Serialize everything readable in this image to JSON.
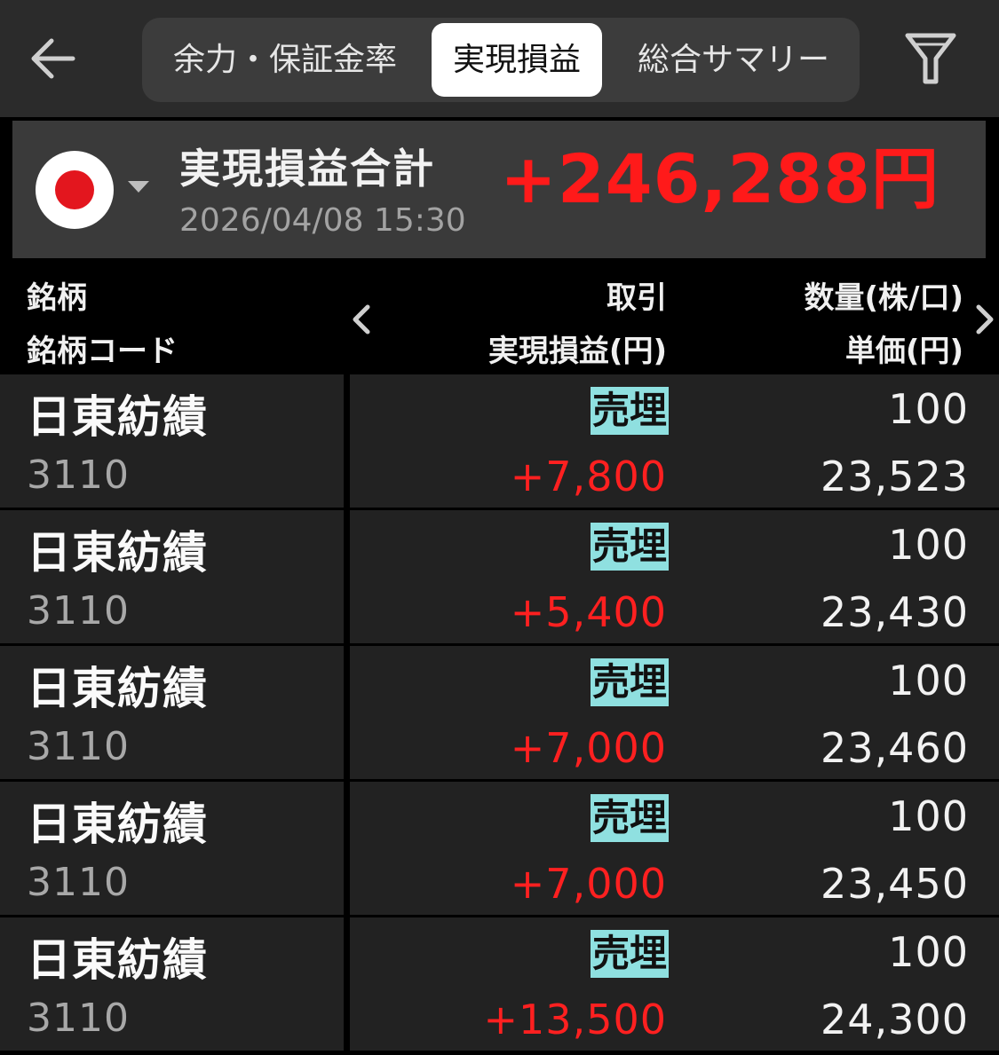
{
  "header": {
    "back_icon": "arrow-left-icon",
    "tabs": [
      {
        "label": "余力・保証金率",
        "selected": false
      },
      {
        "label": "実現損益",
        "selected": true
      },
      {
        "label": "総合サマリー",
        "selected": false
      }
    ],
    "filter_icon": "filter-icon"
  },
  "summary": {
    "flag_icon": "japan-flag-icon",
    "title": "実現損益合計",
    "datetime": "2026/04/08 15:30",
    "total": "+246,288円"
  },
  "table": {
    "columns": {
      "name": "銘柄",
      "code": "銘柄コード",
      "trade": "取引",
      "realized_pl": "実現損益(円)",
      "quantity": "数量(株/口)",
      "unit_price": "単価(円)"
    },
    "nav_prev_icon": "chevron-left-icon",
    "nav_next_icon": "chevron-right-icon",
    "rows": [
      {
        "name": "日東紡績",
        "code": "3110",
        "trade": "売埋",
        "realized_pl": "+7,800",
        "quantity": "100",
        "unit_price": "23,523"
      },
      {
        "name": "日東紡績",
        "code": "3110",
        "trade": "売埋",
        "realized_pl": "+5,400",
        "quantity": "100",
        "unit_price": "23,430"
      },
      {
        "name": "日東紡績",
        "code": "3110",
        "trade": "売埋",
        "realized_pl": "+7,000",
        "quantity": "100",
        "unit_price": "23,460"
      },
      {
        "name": "日東紡績",
        "code": "3110",
        "trade": "売埋",
        "realized_pl": "+7,000",
        "quantity": "100",
        "unit_price": "23,450"
      },
      {
        "name": "日東紡績",
        "code": "3110",
        "trade": "売埋",
        "realized_pl": "+13,500",
        "quantity": "100",
        "unit_price": "24,300"
      }
    ]
  },
  "colors": {
    "profit": "#ff1a1a",
    "trade_badge": "#8fe0e0",
    "background": "#000000",
    "row_background": "#222222"
  }
}
